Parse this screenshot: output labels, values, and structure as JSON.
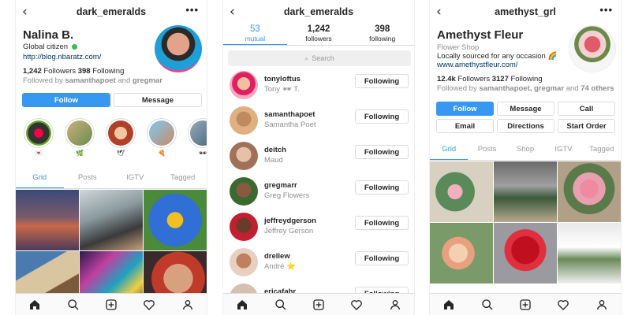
{
  "colors": {
    "accent": "#3897f0",
    "text": "#262626",
    "muted": "#8e8e8e",
    "border": "#dbdbdb"
  },
  "nav_icons": [
    "home-icon",
    "search-icon",
    "add-post-icon",
    "heart-icon",
    "profile-icon"
  ],
  "screen1": {
    "username": "dark_emeralds",
    "name": "Nalina B.",
    "bio": "Global citizen",
    "link": "http://blog.nbaratz.com/",
    "followers_count": "1,242",
    "followers_label": "Followers",
    "following_count": "398",
    "following_label": "Following",
    "followed_by_prefix": "Followed by",
    "followed_by_1": "samanthapoet",
    "followed_by_and": "and",
    "followed_by_2": "gregmar",
    "follow_button": "Follow",
    "message_button": "Message",
    "highlight_icons": [
      "💌",
      "🌿",
      "🕊",
      "🍕",
      "🕶"
    ],
    "tabs": [
      "Grid",
      "Posts",
      "IGTV",
      "Tagged"
    ]
  },
  "screen2": {
    "username": "dark_emeralds",
    "tabs": [
      {
        "count": "53",
        "label": "mutual"
      },
      {
        "count": "1,242",
        "label": "followers"
      },
      {
        "count": "398",
        "label": "following"
      }
    ],
    "search_placeholder": "Search",
    "following_button": "Following",
    "users": [
      {
        "username": "tonyloftus",
        "subtitle": "Tony 🕶 T."
      },
      {
        "username": "samanthapoet",
        "subtitle": "Samantha Poet"
      },
      {
        "username": "deitch",
        "subtitle": "Maud"
      },
      {
        "username": "gregmarr",
        "subtitle": "Greg Flowers"
      },
      {
        "username": "jeffreydgerson",
        "subtitle": "Jeffrey Gerson"
      },
      {
        "username": "drellew",
        "subtitle": "André ⭐"
      },
      {
        "username": "ericafahr",
        "subtitle": ""
      }
    ]
  },
  "screen3": {
    "username": "amethyst_grl",
    "name": "Amethyst Fleur",
    "category": "Flower Shop",
    "bio": "Locally sourced for any occasion 🌈",
    "link": "www.amethystfleur.com/",
    "followers_count": "12.4k",
    "followers_label": "Followers",
    "following_count": "3127",
    "following_label": "Following",
    "followed_by_prefix": "Followed by",
    "followed_by_names": "samanthapoet, gregmar",
    "followed_by_and": "and",
    "followed_by_others": "74 others",
    "buttons": [
      "Follow",
      "Message",
      "Call",
      "Email",
      "Directions",
      "Start Order"
    ],
    "tabs": [
      "Grid",
      "Posts",
      "Shop",
      "IGTV",
      "Tagged"
    ]
  }
}
